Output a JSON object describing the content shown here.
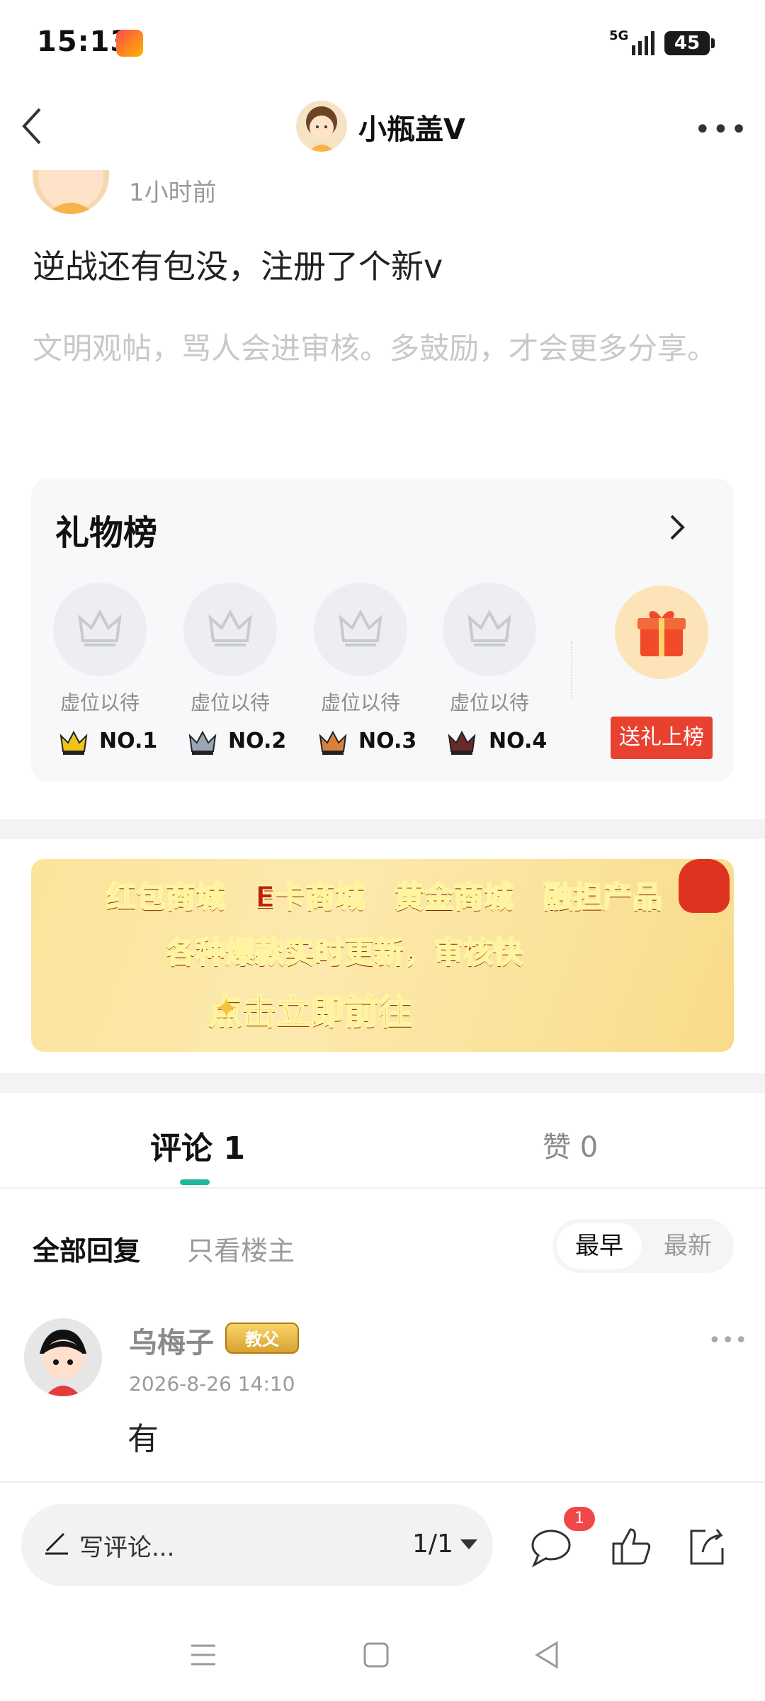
{
  "status_bar": {
    "time": "15:13",
    "network": "5G",
    "battery": "45"
  },
  "header": {
    "title": "小瓶盖V"
  },
  "post": {
    "time": "1小时前",
    "content": "逆战还有包没，注册了个新v",
    "hint": "文明观帖，骂人会进审核。多鼓励，才会更多分享。"
  },
  "gift_board": {
    "title": "礼物榜",
    "slots": [
      {
        "label": "虚位以待",
        "rank": "NO.1",
        "crown_color": "#f0c419"
      },
      {
        "label": "虚位以待",
        "rank": "NO.2",
        "crown_color": "#9aa5b5"
      },
      {
        "label": "虚位以待",
        "rank": "NO.3",
        "crown_color": "#d9813b"
      },
      {
        "label": "虚位以待",
        "rank": "NO.4",
        "crown_color": "#6b2a2a"
      }
    ],
    "send_button": "送礼上榜"
  },
  "banner": {
    "line1": "红包商城　E卡商城　黄金商城　融担产品",
    "line2": "各种爆款实时更新，审核快",
    "cta": "点击立即前往"
  },
  "tabs": {
    "comments": "评论 1",
    "likes": "赞 0"
  },
  "filters": {
    "all": "全部回复",
    "owner_only": "只看楼主",
    "sort_early": "最早",
    "sort_new": "最新"
  },
  "comment": {
    "name": "乌梅子",
    "badge": "教父",
    "time": "2026-8-26 14:10",
    "text": "有"
  },
  "bottom_bar": {
    "input_placeholder": "写评论...",
    "page_indicator": "1/1",
    "message_badge": "1"
  },
  "colors": {
    "accent": "#1fb89a",
    "red": "#e8412f",
    "badge_red": "#f04848"
  }
}
